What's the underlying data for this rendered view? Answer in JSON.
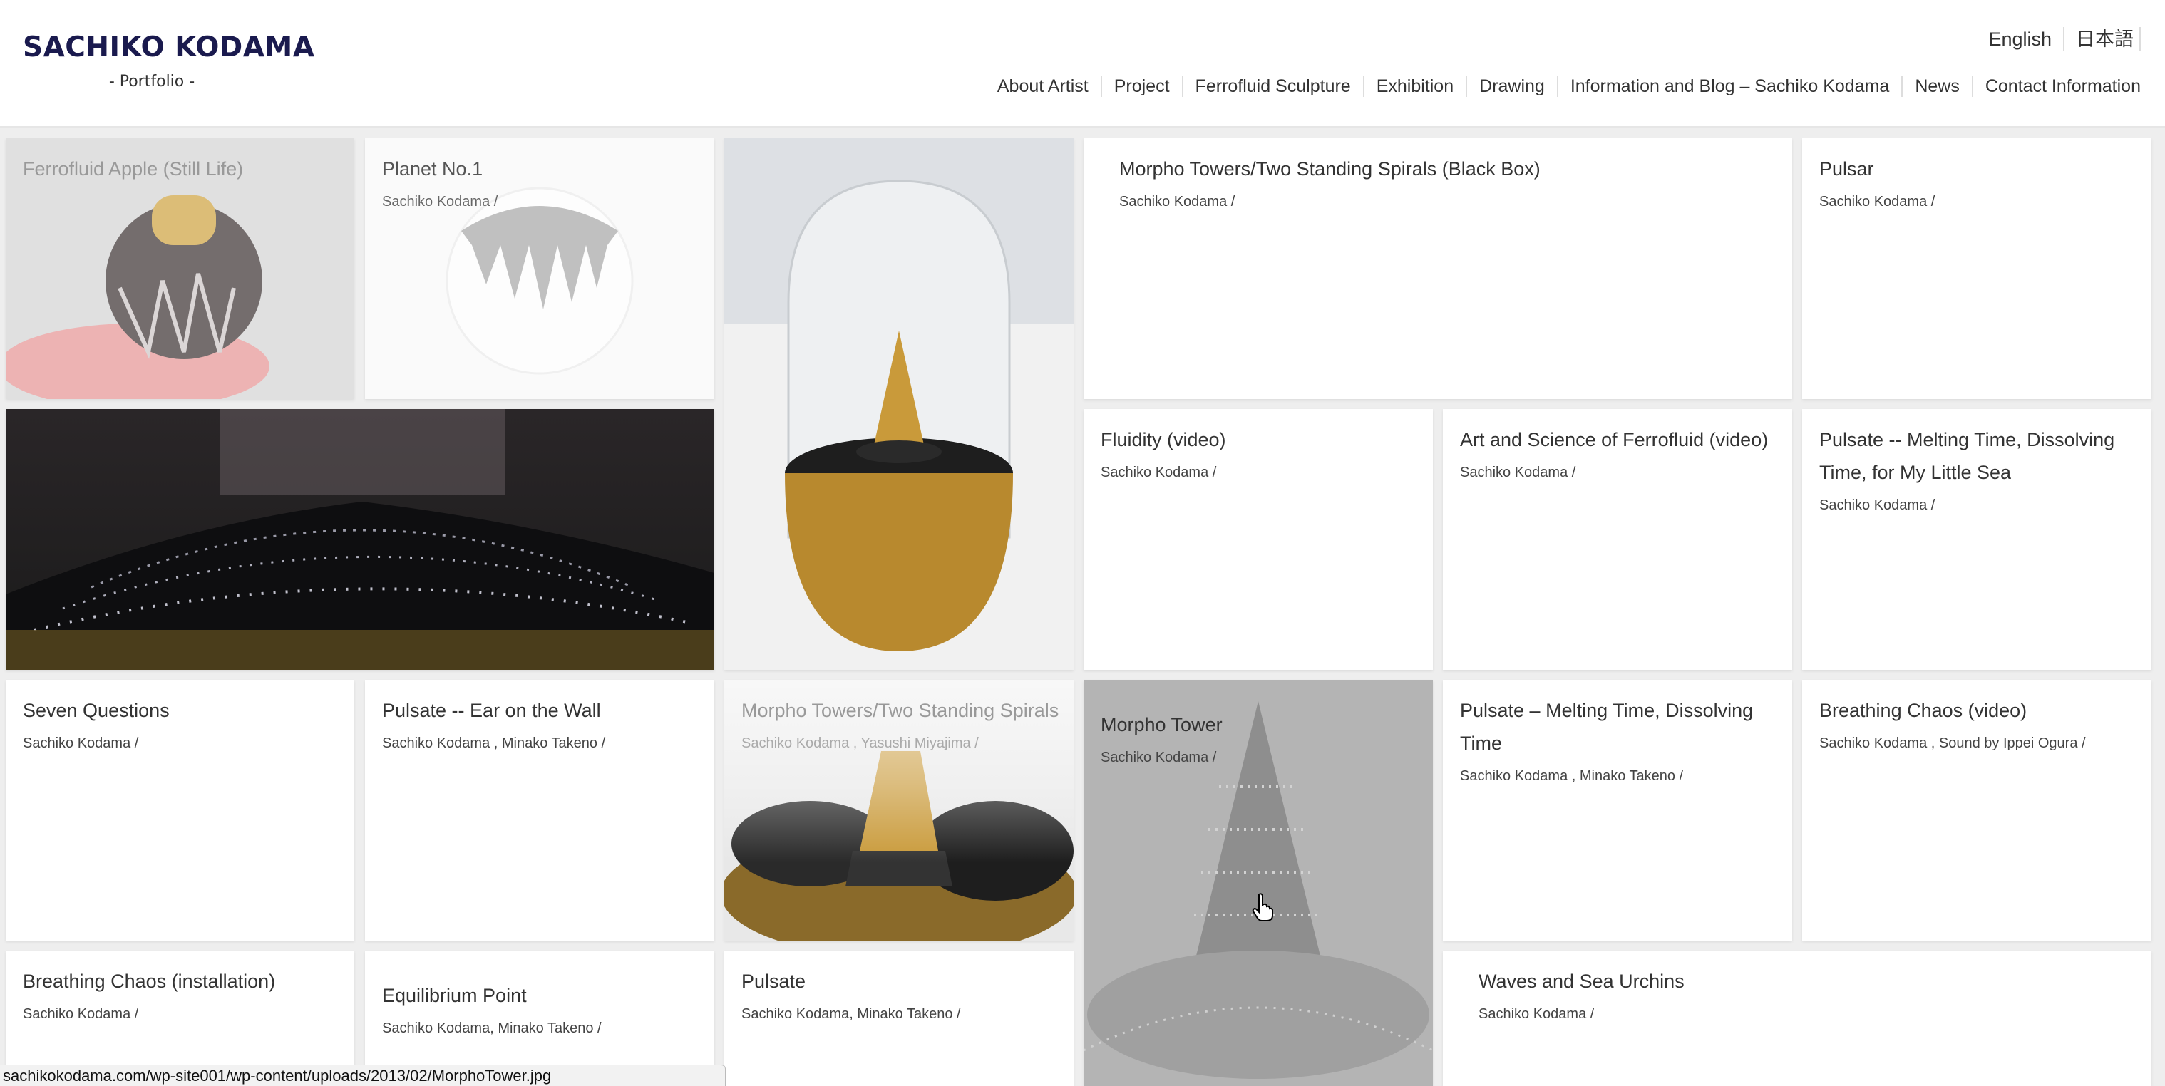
{
  "site": {
    "title": "SACHIKO KODAMA",
    "tagline": "- Portfolio -"
  },
  "languages": [
    "English",
    "日本語"
  ],
  "nav": [
    "About Artist",
    "Project",
    "Ferrofluid Sculpture",
    "Exhibition",
    "Drawing",
    "Information and Blog – Sachiko Kodama",
    "News",
    "Contact Information"
  ],
  "tiles": [
    {
      "title": "Ferrofluid Apple (Still Life)",
      "meta": ""
    },
    {
      "title": "Planet No.1",
      "meta": "Sachiko Kodama /"
    },
    {
      "title": "Morpho Towers/Two Standing Spirals (Black Box)",
      "meta": "Sachiko Kodama /"
    },
    {
      "title": "Pulsar",
      "meta": "Sachiko Kodama /"
    },
    {
      "title": "Fluidity (video)",
      "meta": "Sachiko Kodama /"
    },
    {
      "title": "Art and Science of Ferrofluid (video)",
      "meta": "Sachiko Kodama /"
    },
    {
      "title": "Pulsate -- Melting Time, Dissolving Time, for My Little Sea",
      "meta": "Sachiko Kodama /"
    },
    {
      "title": "Seven Questions",
      "meta": "Sachiko Kodama /"
    },
    {
      "title": "Pulsate -- Ear on the Wall",
      "meta": "Sachiko Kodama , Minako Takeno /"
    },
    {
      "title": "Morpho Towers/Two Standing Spirals",
      "meta": "Sachiko Kodama , Yasushi Miyajima /"
    },
    {
      "title": "Morpho Tower",
      "meta": "Sachiko Kodama /"
    },
    {
      "title": "Pulsate – Melting Time, Dissolving Time",
      "meta": "Sachiko Kodama , Minako Takeno /"
    },
    {
      "title": "Breathing Chaos (video)",
      "meta": "Sachiko Kodama , Sound by Ippei Ogura /"
    },
    {
      "title": "Breathing Chaos (installation)",
      "meta": "Sachiko Kodama /"
    },
    {
      "title": "Equilibrium Point",
      "meta": "Sachiko Kodama, Minako Takeno /"
    },
    {
      "title": "Pulsate",
      "meta": "Sachiko Kodama, Minako Takeno /"
    },
    {
      "title": "Waves and Sea Urchins",
      "meta": "Sachiko Kodama /"
    }
  ],
  "status_url": "sachikokodama.com/wp-site001/wp-content/uploads/2013/02/MorphoTower.jpg"
}
